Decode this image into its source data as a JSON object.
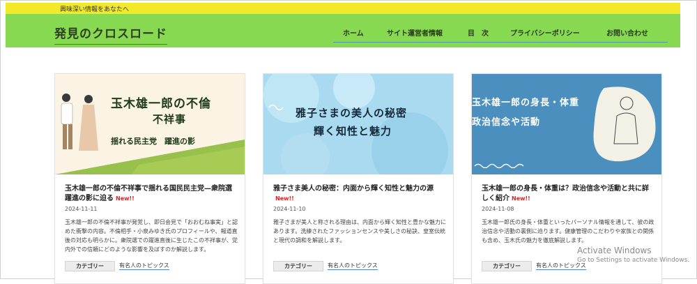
{
  "site": {
    "tagline": "興味深い情報をあなたへ",
    "title": "発見のクロスロード"
  },
  "nav": [
    "ホーム",
    "サイト運営者情報",
    "目　次",
    "プライバシーポリシー",
    "お問い合わせ"
  ],
  "colors": {
    "topbar": "#f2e92a",
    "header": "#86d951",
    "new_badge": "#e02020",
    "link_underline": "#4a7fd4"
  },
  "cards": [
    {
      "thumb_lines": [
        "玉木雄一郎の不倫",
        "不祥事",
        "揺れる民主党　躍進の影"
      ],
      "title": "玉木雄一郎の不倫不祥事で揺れる国民民主党—衆院選躍進の影に迫る",
      "new": "New!!",
      "date": "2024-11-11",
      "excerpt": "玉木雄一郎の不倫不祥事が発覚し、即日会見で「おおむね事実」と認めた衝撃の内容。不倫相手・小泉みゆき氏のプロフィールや、報道直後の対応も明らかに。衆院選での躍進直後に生じたこの不祥事が、党内外での信頼にどのような影響を及ぼすのか解説します。",
      "category": "カテゴリー",
      "tag": "有名人のトピックス"
    },
    {
      "thumb_lines": [
        "雅子さまの美人の秘密",
        "輝く知性と魅力"
      ],
      "title": "雅子さま美人の秘密：内面から輝く知性と魅力の源",
      "new": "New!!",
      "date": "2024-11-10",
      "excerpt": "雅子さまが美人と称される理由は、内面から輝く知性と豊かな魅力にあります。洗練されたファッションセンスや美しさの秘訣、皇室伝統と現代の調和を解説します。",
      "category": "カテゴリー",
      "tag": "有名人のトピックス"
    },
    {
      "thumb_lines": [
        "玉木雄一郎の身長・体重",
        "政治信念や活動"
      ],
      "title": "玉木雄一郎の身長・体重は？政治信念や活動と共に詳しく紹介",
      "new": "New!!",
      "date": "2024-11-08",
      "excerpt": "玉木雄一郎氏の身長・体重といったパーソナル情報を通して、彼の政治信念や活動の裏側に迫ります。健康管理のこだわりや家族との関係も含め、玉木氏の魅力を徹底解説します。",
      "category": "カテゴリー",
      "tag": "有名人のトピックス"
    }
  ],
  "watermark": {
    "title": "Activate Windows",
    "subtitle": "Go to Settings to activate Windows."
  }
}
